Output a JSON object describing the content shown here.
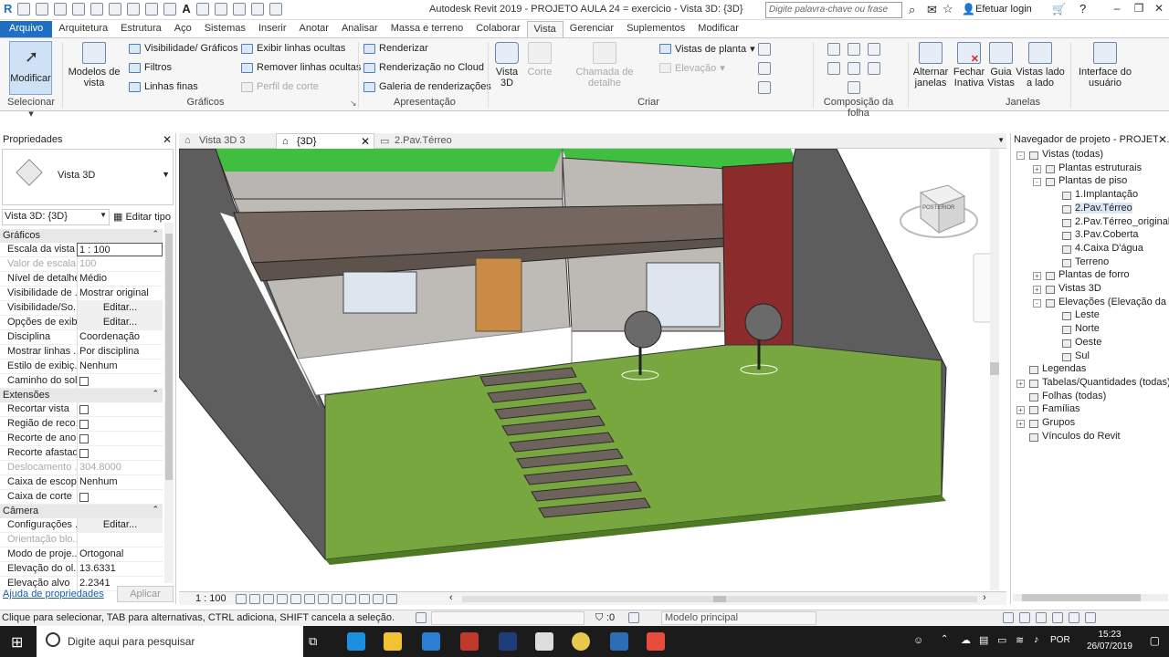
{
  "titlebar": {
    "title": "Autodesk Revit 2019 - PROJETO AULA 24 = exercicio - Vista 3D: {3D}",
    "search_placeholder": "Digite palavra-chave ou frase",
    "login": "Efetuar login"
  },
  "menu": [
    "Arquivo",
    "Arquitetura",
    "Estrutura",
    "Aço",
    "Sistemas",
    "Inserir",
    "Anotar",
    "Analisar",
    "Massa e terreno",
    "Colaborar",
    "Vista",
    "Gerenciar",
    "Suplementos",
    "Modificar"
  ],
  "ribbon": {
    "modify": "Modificar",
    "select": "Selecionar",
    "graphics": {
      "view_templates": "Modelos de vista",
      "visibility": "Visibilidade/ Gráficos",
      "filters": "Filtros",
      "thin_lines": "Linhas finas",
      "show_hidden": "Exibir linhas ocultas",
      "remove_hidden": "Remover linhas ocultas",
      "cut_profile": "Perfil de corte",
      "label": "Gráficos"
    },
    "presentation": {
      "render": "Renderizar",
      "cloud": "Renderização no Cloud",
      "gallery": "Galeria de renderizações",
      "label": "Apresentação"
    },
    "create": {
      "view3d": "Vista 3D",
      "section": "Corte",
      "callout": "Chamada de detalhe",
      "plan_views": "Vistas de planta",
      "elevation": "Elevação",
      "label": "Criar"
    },
    "sheet_label": "Composição da folha",
    "windows": {
      "switch": "Alternar janelas",
      "close_inactive": "Fechar Inativa",
      "tab_views": "Guia Vistas",
      "tile": "Vistas lado a lado",
      "label": "Janelas"
    },
    "ui": "Interface do usuário"
  },
  "properties": {
    "title": "Propriedades",
    "type": "Vista 3D",
    "instance": "Vista 3D: {3D}",
    "edit_type": "Editar tipo",
    "categories": [
      {
        "name": "Gráficos",
        "rows": [
          {
            "k": "Escala da vista",
            "v": "1 : 100",
            "input": true
          },
          {
            "k": "Valor de escala...",
            "v": "100",
            "dim": true
          },
          {
            "k": "Nível de detalhe",
            "v": "Médio"
          },
          {
            "k": "Visibilidade de ...",
            "v": "Mostrar original"
          },
          {
            "k": "Visibilidade/So...",
            "v": "Editar...",
            "btn": true
          },
          {
            "k": "Opções de exib...",
            "v": "Editar...",
            "btn": true
          },
          {
            "k": "Disciplina",
            "v": "Coordenação"
          },
          {
            "k": "Mostrar linhas ...",
            "v": "Por disciplina"
          },
          {
            "k": "Estilo de exibiç...",
            "v": "Nenhum"
          },
          {
            "k": "Caminho do sol",
            "v": "",
            "check": true
          }
        ]
      },
      {
        "name": "Extensões",
        "rows": [
          {
            "k": "Recortar vista",
            "v": "",
            "check": true
          },
          {
            "k": "Região de reco...",
            "v": "",
            "check": true
          },
          {
            "k": "Recorte de ano...",
            "v": "",
            "check": true
          },
          {
            "k": "Recorte afastad...",
            "v": "",
            "check": true
          },
          {
            "k": "Deslocamento ...",
            "v": "304.8000",
            "dim": true
          },
          {
            "k": "Caixa de escopo",
            "v": "Nenhum"
          },
          {
            "k": "Caixa de corte",
            "v": "",
            "check": true
          }
        ]
      },
      {
        "name": "Câmera",
        "rows": [
          {
            "k": "Configurações ...",
            "v": "Editar...",
            "btn": true
          },
          {
            "k": "Orientação blo...",
            "v": "",
            "dim": true
          },
          {
            "k": "Modo de proje...",
            "v": "Ortogonal"
          },
          {
            "k": "Elevação do ol...",
            "v": "13.6331"
          },
          {
            "k": "Elevação alvo",
            "v": "2.2341"
          }
        ]
      }
    ],
    "help": "Ajuda de propriedades",
    "apply": "Aplicar"
  },
  "view_tabs": [
    "Vista 3D 3",
    "{3D}",
    "2.Pav.Térreo"
  ],
  "view_scale": "1 : 100",
  "viewcube": "POSTERIOR",
  "browser": {
    "title": "Navegador de projeto - PROJETO...",
    "nodes": [
      {
        "t": "Vistas (todas)",
        "lvl": 0,
        "exp": "-"
      },
      {
        "t": "Plantas estruturais",
        "lvl": 1,
        "exp": "+"
      },
      {
        "t": "Plantas de piso",
        "lvl": 1,
        "exp": "-"
      },
      {
        "t": "1.Implantação",
        "lvl": 2
      },
      {
        "t": "2.Pav.Térreo",
        "lvl": 2,
        "sel": true
      },
      {
        "t": "2.Pav.Térreo_original",
        "lvl": 2
      },
      {
        "t": "3.Pav.Coberta",
        "lvl": 2
      },
      {
        "t": "4.Caixa D'água",
        "lvl": 2
      },
      {
        "t": "Terreno",
        "lvl": 2
      },
      {
        "t": "Plantas de forro",
        "lvl": 1,
        "exp": "+"
      },
      {
        "t": "Vistas 3D",
        "lvl": 1,
        "exp": "+"
      },
      {
        "t": "Elevações (Elevação da constru",
        "lvl": 1,
        "exp": "-"
      },
      {
        "t": "Leste",
        "lvl": 2
      },
      {
        "t": "Norte",
        "lvl": 2
      },
      {
        "t": "Oeste",
        "lvl": 2
      },
      {
        "t": "Sul",
        "lvl": 2
      },
      {
        "t": "Legendas",
        "lvl": 0
      },
      {
        "t": "Tabelas/Quantidades (todas)",
        "lvl": 0,
        "exp": "+"
      },
      {
        "t": "Folhas (todas)",
        "lvl": 0
      },
      {
        "t": "Famílias",
        "lvl": 0,
        "exp": "+"
      },
      {
        "t": "Grupos",
        "lvl": 0,
        "exp": "+"
      },
      {
        "t": "Vínculos do Revit",
        "lvl": 0
      }
    ]
  },
  "status": {
    "hint": "Clique para selecionar, TAB para alternativas, CTRL adiciona, SHIFT cancela a seleção.",
    "count": ":0",
    "model": "Modelo principal"
  },
  "taskbar": {
    "search": "Digite aqui para pesquisar",
    "lang": "POR",
    "time": "15:23",
    "date": "26/07/2019"
  }
}
